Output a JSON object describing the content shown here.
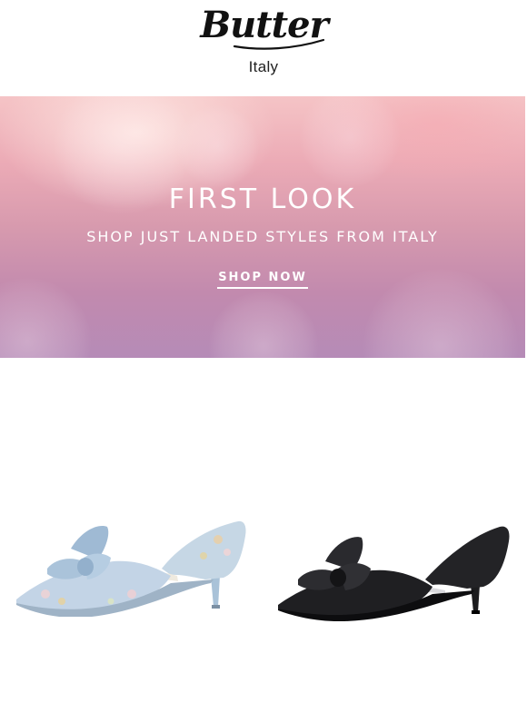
{
  "brand": {
    "name": "Butter",
    "subtitle": "Italy"
  },
  "hero": {
    "title": "FIRST LOOK",
    "subtitle": "SHOP JUST LANDED STYLES FROM ITALY",
    "cta_label": "SHOP NOW"
  },
  "products": [
    {
      "icon": "pale-blue-floral-kitten-heel-bow-pump",
      "color": "#b9cfe3"
    },
    {
      "icon": "black-kitten-heel-bow-pump",
      "color": "#1c1c1e"
    }
  ]
}
